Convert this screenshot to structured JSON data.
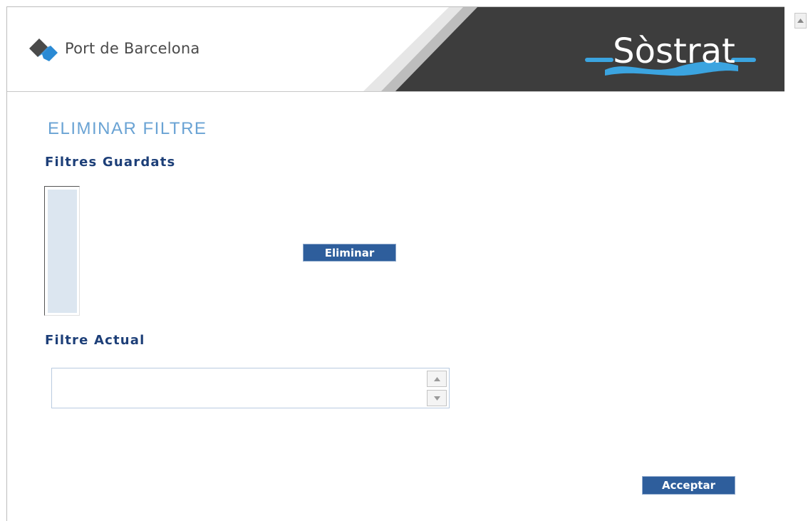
{
  "header": {
    "left_logo_text": "Port de Barcelona",
    "right_logo_text": "Sòstrat"
  },
  "page": {
    "title": "ELIMINAR FILTRE",
    "saved_filters_label": "Filtres Guardats",
    "saved_filters_items": [],
    "delete_button": "Eliminar",
    "current_filter_label": "Filtre Actual",
    "current_filter_value": "",
    "accept_button": "Acceptar"
  },
  "colors": {
    "title": "#6aa3d4",
    "label": "#1d3f78",
    "button": "#2e5e9c",
    "header_dark": "#3a3a3a",
    "wave_blue": "#3ba4e0"
  },
  "icons": [
    "port-de-barcelona-logo-icon",
    "sostrat-logo-icon",
    "scroll-up-arrow-icon",
    "scroll-down-arrow-icon"
  ]
}
